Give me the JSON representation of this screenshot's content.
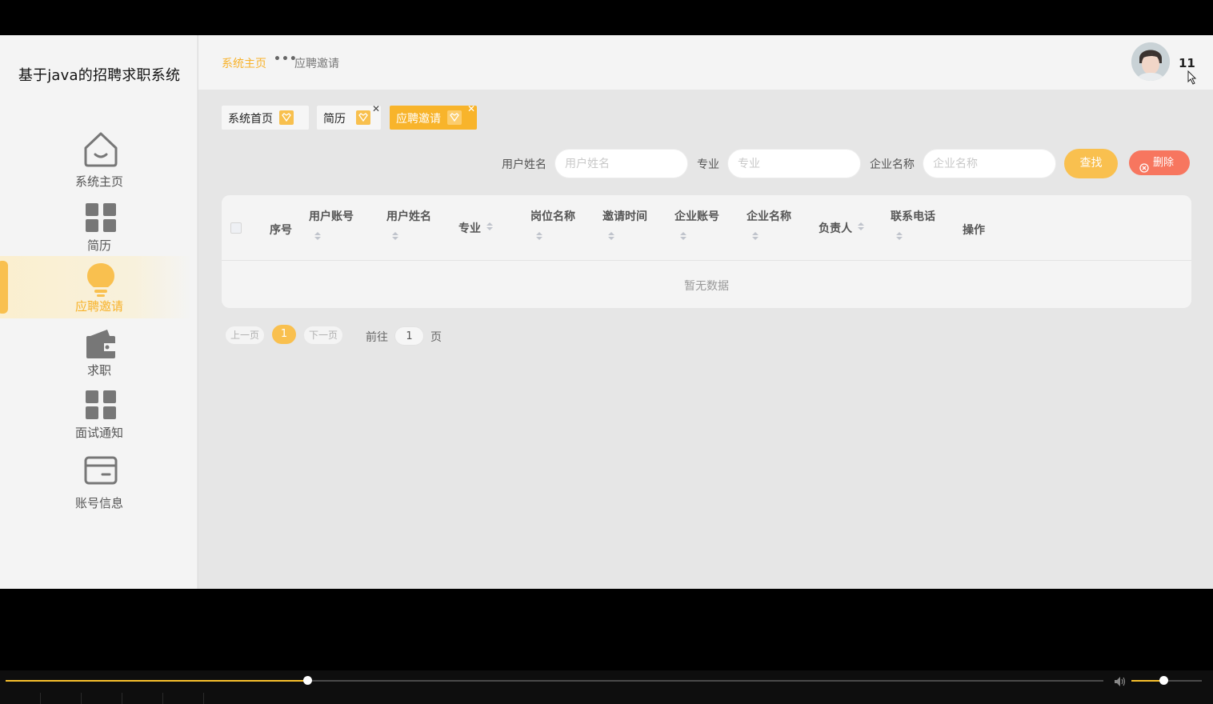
{
  "app": {
    "title": "基于java的招聘求职系统"
  },
  "sidebar": {
    "items": [
      {
        "label": "系统主页",
        "icon": "home-icon",
        "active": false
      },
      {
        "label": "简历",
        "icon": "grid-icon",
        "active": false
      },
      {
        "label": "应聘邀请",
        "icon": "lightbulb-icon",
        "active": true
      },
      {
        "label": "求职",
        "icon": "wallet-icon",
        "active": false
      },
      {
        "label": "面试通知",
        "icon": "grid-icon",
        "active": false
      },
      {
        "label": "账号信息",
        "icon": "card-icon",
        "active": false
      }
    ]
  },
  "header": {
    "breadcrumb_home": "系统主页",
    "breadcrumb_current": "应聘邀请",
    "user_name": "11"
  },
  "tags": [
    {
      "label": "系统首页",
      "closable": false,
      "active": false
    },
    {
      "label": "简历",
      "closable": true,
      "active": false
    },
    {
      "label": "应聘邀请",
      "closable": true,
      "active": true
    }
  ],
  "search": {
    "fields": [
      {
        "label": "用户姓名",
        "placeholder": "用户姓名"
      },
      {
        "label": "专业",
        "placeholder": "专业"
      },
      {
        "label": "企业名称",
        "placeholder": "企业名称"
      }
    ],
    "search_button": "查找",
    "delete_button": "删除"
  },
  "table": {
    "columns": [
      "序号",
      "用户账号",
      "用户姓名",
      "专业",
      "岗位名称",
      "邀请时间",
      "企业账号",
      "企业名称",
      "负责人",
      "联系电话",
      "操作"
    ],
    "rows": [],
    "empty_text": "暂无数据"
  },
  "pagination": {
    "prev": "上一页",
    "current_page": "1",
    "next": "下一页",
    "goto_label": "前往",
    "goto_value": "1",
    "page_suffix": "页"
  },
  "player": {
    "progress": 0.275,
    "volume": 0.45
  },
  "colors": {
    "accent": "#f8b22a",
    "danger": "#f7765f",
    "sidebar_bg": "#f4f4f4",
    "content_bg": "#e6e6e6"
  }
}
